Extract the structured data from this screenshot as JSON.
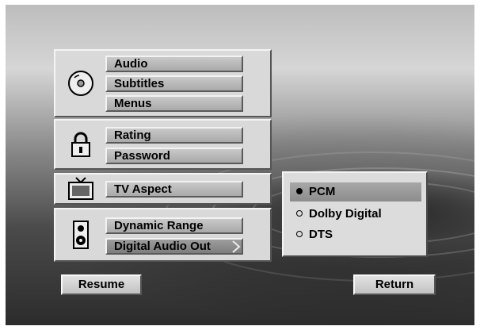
{
  "menu": {
    "groups": [
      {
        "icon": "disc-icon",
        "items": [
          "Audio",
          "Subtitles",
          "Menus"
        ]
      },
      {
        "icon": "lock-icon",
        "items": [
          "Rating",
          "Password"
        ]
      },
      {
        "icon": "tv-icon",
        "items": [
          "TV Aspect"
        ]
      },
      {
        "icon": "speaker-icon",
        "items": [
          "Dynamic Range",
          "Digital Audio Out"
        ]
      }
    ],
    "selected_item": "Digital Audio Out"
  },
  "submenu": {
    "options": [
      "PCM",
      "Dolby Digital",
      "DTS"
    ],
    "selected": "PCM"
  },
  "buttons": {
    "resume": "Resume",
    "return": "Return"
  }
}
